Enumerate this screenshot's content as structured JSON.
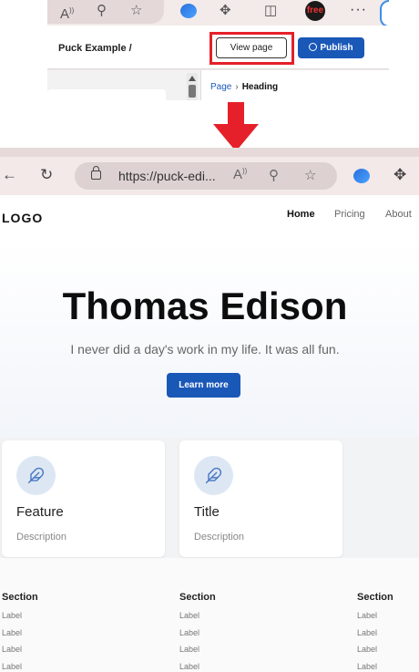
{
  "editor": {
    "title": "Puck Example /",
    "view_page_label": "View page",
    "publish_label": "Publish",
    "breadcrumb_parent": "Page",
    "breadcrumb_current": "Heading",
    "free_badge": "free"
  },
  "browser": {
    "url": "https://puck-edi..."
  },
  "site": {
    "logo": "LOGO",
    "nav": [
      "Home",
      "Pricing",
      "About"
    ],
    "hero": {
      "title": "Thomas Edison",
      "subtitle": "I never did a day's work in my life. It was all fun.",
      "button": "Learn more"
    },
    "features": [
      {
        "title": "Feature",
        "description": "Description"
      },
      {
        "title": "Title",
        "description": "Description"
      }
    ],
    "footer": [
      {
        "title": "Section",
        "links": [
          "Label",
          "Label",
          "Label",
          "Label"
        ]
      },
      {
        "title": "Section",
        "links": [
          "Label",
          "Label",
          "Label",
          "Label"
        ]
      },
      {
        "title": "Section",
        "links": [
          "Label",
          "Label",
          "Label",
          "Label"
        ]
      }
    ]
  },
  "colors": {
    "accent": "#1a58b8",
    "highlight": "#e5202a"
  }
}
